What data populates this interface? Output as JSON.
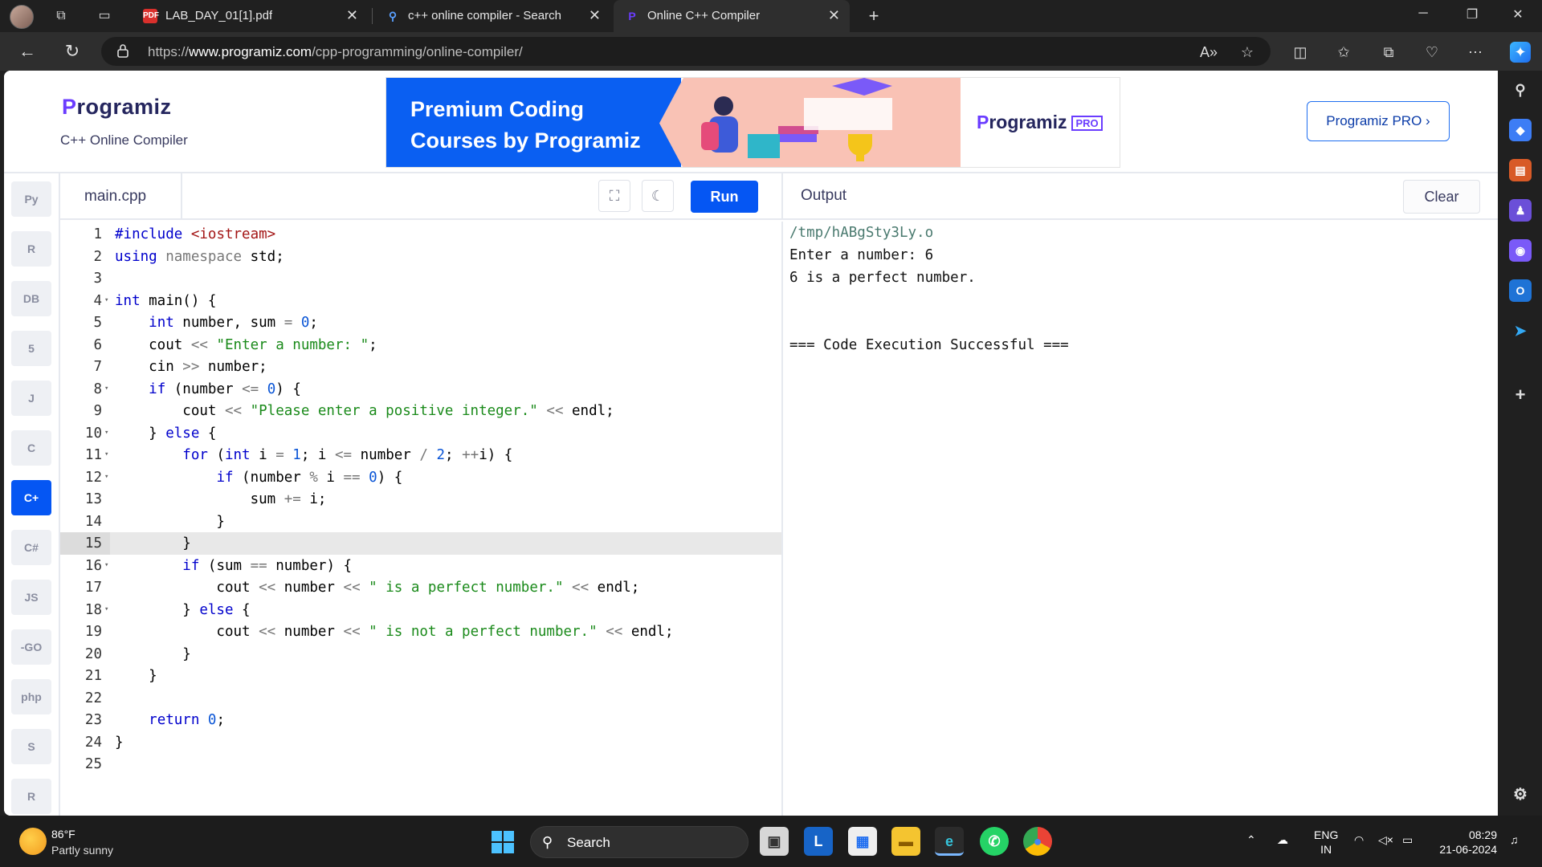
{
  "browser": {
    "tabs": [
      {
        "title": "LAB_DAY_01[1].pdf",
        "favicon": "pdf-icon"
      },
      {
        "title": "c++ online compiler - Search",
        "favicon": "search-icon"
      },
      {
        "title": "Online C++ Compiler",
        "favicon": "programiz-icon"
      }
    ],
    "url_prefix": "https://",
    "url_host": "www.programiz.com",
    "url_path": "/cpp-programming/online-compiler/"
  },
  "header": {
    "logo": "rogramiz",
    "logo_letter": "P",
    "subtitle": "C++ Online Compiler",
    "banner_line1": "Premium Coding",
    "banner_line2": "Courses by Programiz",
    "banner_logo": "rogramiz",
    "banner_logo_letter": "P",
    "banner_pro": "PRO",
    "pro_button": "Programiz PRO ›"
  },
  "languages": [
    {
      "name": "python-icon",
      "label": "Py"
    },
    {
      "name": "r-icon",
      "label": "R"
    },
    {
      "name": "sql-icon",
      "label": "DB"
    },
    {
      "name": "html5-icon",
      "label": "5"
    },
    {
      "name": "java-icon",
      "label": "J"
    },
    {
      "name": "c-icon",
      "label": "C"
    },
    {
      "name": "cpp-icon",
      "label": "C+",
      "active": true
    },
    {
      "name": "csharp-icon",
      "label": "C#"
    },
    {
      "name": "javascript-icon",
      "label": "JS"
    },
    {
      "name": "go-icon",
      "label": "-GO"
    },
    {
      "name": "php-icon",
      "label": "php"
    },
    {
      "name": "swift-icon",
      "label": "S"
    },
    {
      "name": "rust-icon",
      "label": "R"
    }
  ],
  "editor": {
    "filename": "main.cpp",
    "run_label": "Run",
    "highlighted_line": 15,
    "lines": [
      "#include <iostream>",
      "using namespace std;",
      "",
      "int main() {",
      "    int number, sum = 0;",
      "    cout << \"Enter a number: \";",
      "    cin >> number;",
      "    if (number <= 0) {",
      "        cout << \"Please enter a positive integer.\" << endl;",
      "    } else {",
      "        for (int i = 1; i <= number / 2; ++i) {",
      "            if (number % i == 0) {",
      "                sum += i;",
      "            }",
      "        }",
      "        if (sum == number) {",
      "            cout << number << \" is a perfect number.\" << endl;",
      "        } else {",
      "            cout << number << \" is not a perfect number.\" << endl;",
      "        }",
      "    }",
      "",
      "    return 0;",
      "}",
      ""
    ],
    "fold_lines": [
      4,
      8,
      10,
      11,
      12,
      16,
      18
    ]
  },
  "output": {
    "title": "Output",
    "clear_label": "Clear",
    "lines": [
      "/tmp/hABgSty3Ly.o",
      "Enter a number: 6",
      "6 is a perfect number.",
      "",
      "",
      "=== Code Execution Successful ==="
    ]
  },
  "taskbar": {
    "temperature": "86°F",
    "weather": "Partly sunny",
    "search_label": "Search",
    "lang_top": "ENG",
    "lang_bottom": "IN",
    "time": "08:29",
    "date": "21-06-2024"
  },
  "colors": {
    "accent": "#0556f3",
    "keyword": "#0000ff",
    "string": "#a31515",
    "include": "#0000ff"
  }
}
